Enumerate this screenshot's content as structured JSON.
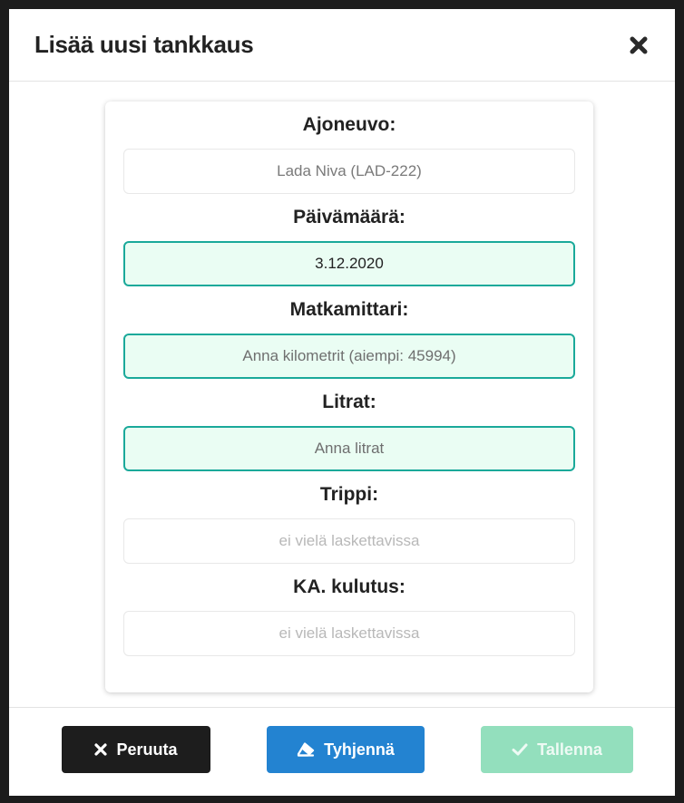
{
  "dialog": {
    "title": "Lisää uusi tankkaus",
    "close_icon": "close-icon"
  },
  "form": {
    "vehicle": {
      "label": "Ajoneuvo:",
      "value": "Lada Niva (LAD-222)"
    },
    "date": {
      "label": "Päivämäärä:",
      "value": "3.12.2020"
    },
    "odometer": {
      "label": "Matkamittari:",
      "placeholder": "Anna kilometrit (aiempi: 45994)"
    },
    "liters": {
      "label": "Litrat:",
      "placeholder": "Anna litrat"
    },
    "trip": {
      "label": "Trippi:",
      "value": "ei vielä laskettavissa"
    },
    "avg_consumption": {
      "label": "KA. kulutus:",
      "value": "ei vielä laskettavissa"
    }
  },
  "footer": {
    "cancel_label": "Peruuta",
    "cancel_icon": "times-icon",
    "clear_label": "Tyhjennä",
    "clear_icon": "eraser-icon",
    "save_label": "Tallenna",
    "save_icon": "check-icon"
  },
  "colors": {
    "active_border": "#1aa99a",
    "active_bg": "#eafdf3",
    "cancel_bg": "#1d1d1d",
    "clear_bg": "#2383d1",
    "save_bg_disabled": "#93dfbd"
  }
}
